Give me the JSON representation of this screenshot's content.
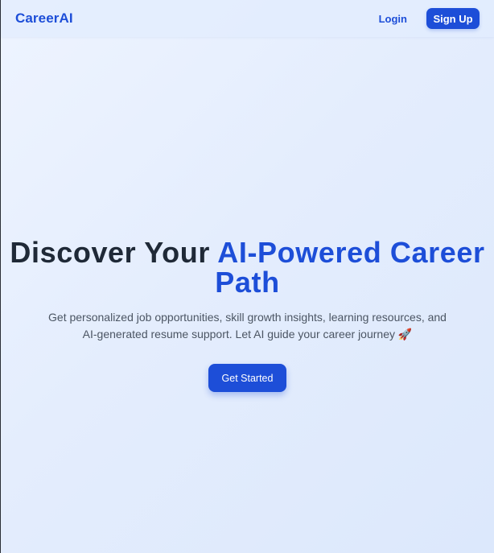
{
  "nav": {
    "logo": "CareerAI",
    "login_label": "Login",
    "signup_label": "Sign Up"
  },
  "hero": {
    "title_part1": "Discover Your ",
    "title_accent": "AI-Powered Career Path",
    "subtitle": "Get personalized job opportunities, skill growth insights, learning resources, and AI-generated resume support. Let AI guide your career journey 🚀",
    "cta_label": "Get Started"
  },
  "colors": {
    "brand": "#1d4ed8",
    "heading": "#1f2937",
    "body_text": "#4b5563",
    "background": "#e4edfd"
  }
}
